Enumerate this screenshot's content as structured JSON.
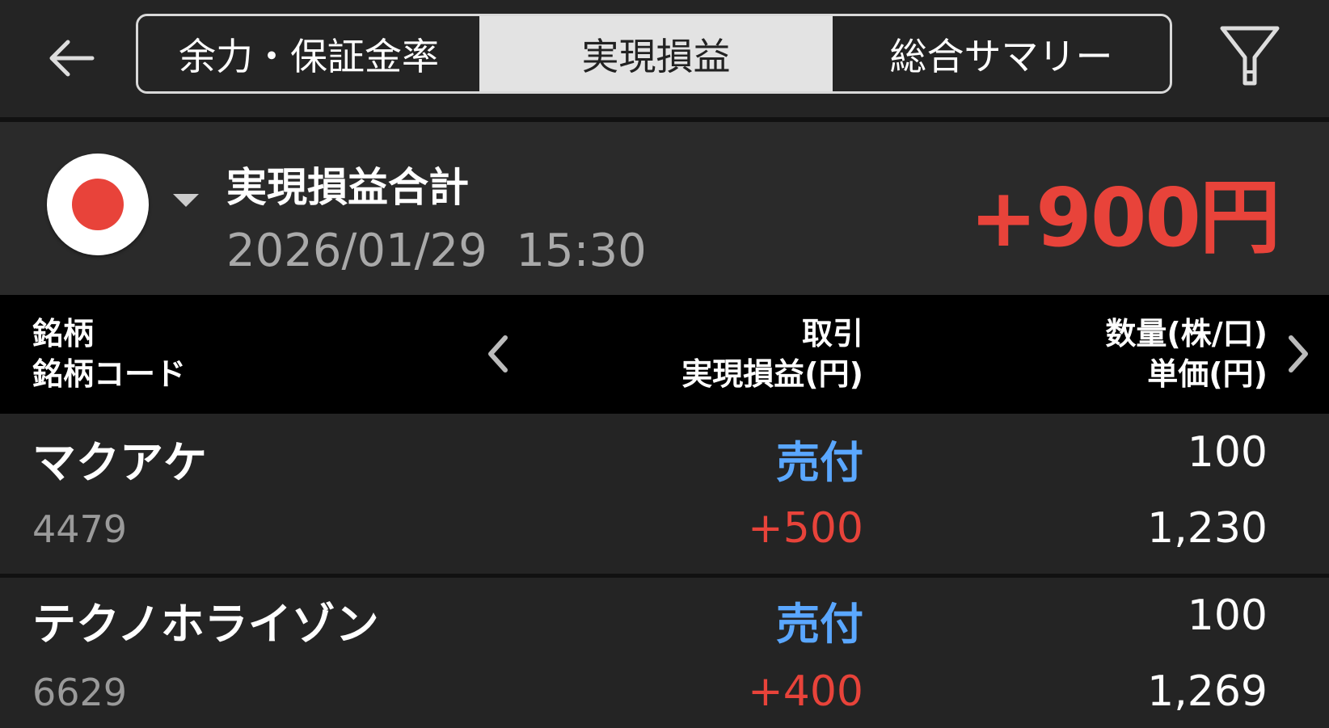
{
  "header": {
    "tabs": [
      {
        "label": "余力・保証金率",
        "active": false
      },
      {
        "label": "実現損益",
        "active": true
      },
      {
        "label": "総合サマリー",
        "active": false
      }
    ]
  },
  "summary": {
    "title": "実現損益合計",
    "date": "2026/01/29  15:30",
    "total": "+900円",
    "market_flag": "japan-flag-icon"
  },
  "table": {
    "columns": {
      "left_line1": "銘柄",
      "left_line2": "銘柄コード",
      "mid_line1": "取引",
      "mid_line2": "実現損益(円)",
      "right_line1": "数量(株/口)",
      "right_line2": "単価(円)"
    },
    "rows": [
      {
        "name": "マクアケ",
        "code": "4479",
        "trade": "売付",
        "pnl": "+500",
        "qty": "100",
        "price": "1,230"
      },
      {
        "name": "テクノホライゾン",
        "code": "6629",
        "trade": "売付",
        "pnl": "+400",
        "qty": "100",
        "price": "1,269"
      }
    ]
  },
  "colors": {
    "background": "#242424",
    "profit_red": "#e8433a",
    "trade_blue": "#5aa7ff",
    "header_black": "#000000"
  }
}
